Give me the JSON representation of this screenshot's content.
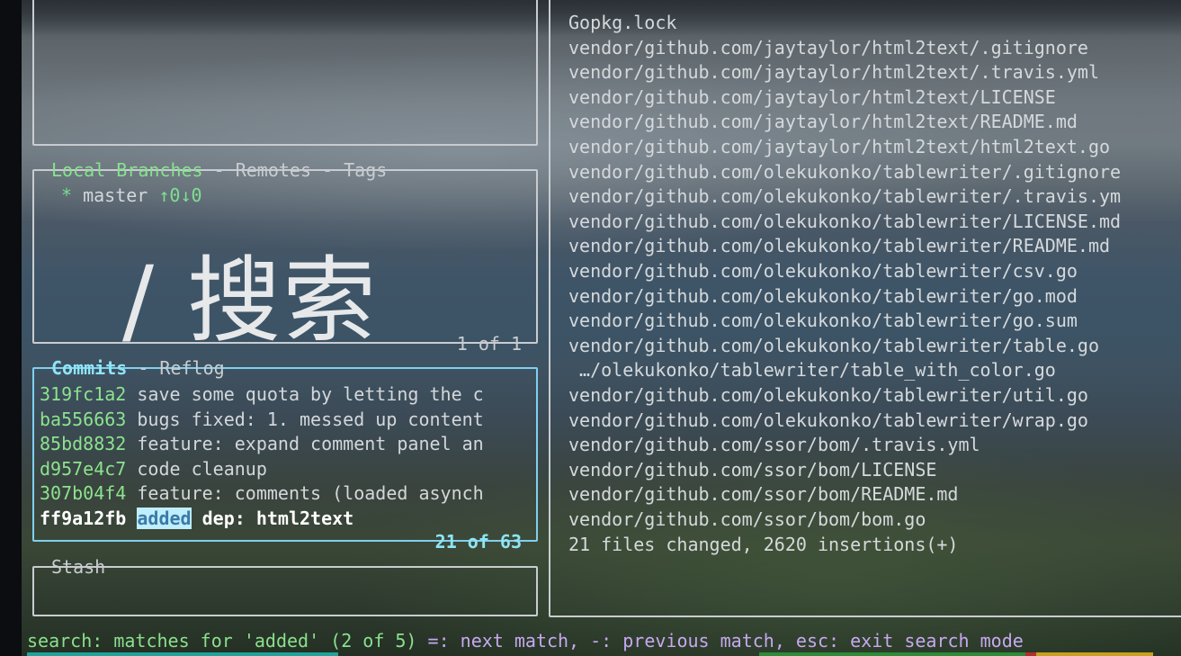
{
  "branches_panel": {
    "tabs": [
      "Local Branches",
      "Remotes",
      "Tags"
    ],
    "tab_separator": " - ",
    "branch": {
      "marker": "*",
      "name": "master",
      "status": "↑0↓0"
    },
    "footer": "1 of 1"
  },
  "overlay": {
    "search_caption": "/ 搜索"
  },
  "commits_panel": {
    "tabs": [
      "Commits",
      "Reflog"
    ],
    "tab_separator": " - ",
    "items": [
      {
        "hash": "319fc1a2",
        "message": "save some quota by letting the c"
      },
      {
        "hash": "ba556663",
        "message": "bugs fixed: 1. messed up content"
      },
      {
        "hash": "85bd8832",
        "message": "feature: expand comment panel an"
      },
      {
        "hash": "d957e4c7",
        "message": "code cleanup"
      },
      {
        "hash": "307b04f4",
        "message": "feature: comments (loaded asynch"
      }
    ],
    "selected": {
      "hash": "ff9a12fb",
      "match": "added",
      "rest": " dep: html2text"
    },
    "footer": "21 of 63"
  },
  "stash_panel": {
    "title": "Stash"
  },
  "files_panel": {
    "files": [
      "Gopkg.lock",
      "vendor/github.com/jaytaylor/html2text/.gitignore",
      "vendor/github.com/jaytaylor/html2text/.travis.yml",
      "vendor/github.com/jaytaylor/html2text/LICENSE",
      "vendor/github.com/jaytaylor/html2text/README.md",
      "vendor/github.com/jaytaylor/html2text/html2text.go",
      "vendor/github.com/olekukonko/tablewriter/.gitignore",
      "vendor/github.com/olekukonko/tablewriter/.travis.ym",
      "vendor/github.com/olekukonko/tablewriter/LICENSE.md",
      "vendor/github.com/olekukonko/tablewriter/README.md",
      "vendor/github.com/olekukonko/tablewriter/csv.go",
      "vendor/github.com/olekukonko/tablewriter/go.mod",
      "vendor/github.com/olekukonko/tablewriter/go.sum",
      "vendor/github.com/olekukonko/tablewriter/table.go",
      " …/olekukonko/tablewriter/table_with_color.go",
      "vendor/github.com/olekukonko/tablewriter/util.go",
      "vendor/github.com/olekukonko/tablewriter/wrap.go",
      "vendor/github.com/ssor/bom/.travis.yml",
      "vendor/github.com/ssor/bom/LICENSE",
      "vendor/github.com/ssor/bom/README.md",
      "vendor/github.com/ssor/bom/bom.go"
    ],
    "summary": "21 files changed, 2620 insertions(+)"
  },
  "status_bar": {
    "prefix": "search: matches for 'added' (2 of 5)",
    "help": " =: next match, -: previous match, esc: exit search mode"
  },
  "colors": {
    "accent_green": "#86e28f",
    "accent_cyan": "#8ee4f5",
    "active_border": "#7fd0f0",
    "match_highlight": "#bfeefd",
    "status_help": "#c7a8f0"
  }
}
